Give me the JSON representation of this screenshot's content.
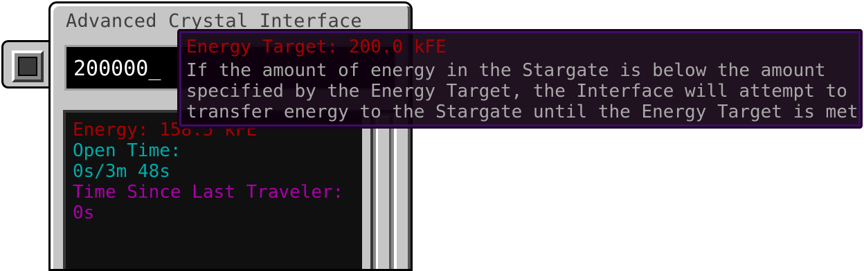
{
  "window": {
    "title": "Advanced Crystal Interface"
  },
  "side_button": {
    "icon": "square-slot-icon"
  },
  "energy_input": {
    "value": "200000_"
  },
  "info": {
    "energy": "Energy: 158.5 kFE",
    "open_time_label": "Open Time:",
    "open_time_value": "0s/3m 48s",
    "last_traveler_label": "Time Since Last Traveler:",
    "last_traveler_value": "0s"
  },
  "tooltip": {
    "title": "Energy Target: 200.0 kFE",
    "lines": [
      "If the amount of energy in the Stargate is below the amount",
      "specified by the Energy Target, the Interface will attempt to",
      "transfer energy to the Stargate until the Energy Target is met"
    ]
  },
  "colors": {
    "energy": "#aa0000",
    "open_time": "#00aaaa",
    "traveler": "#aa00aa",
    "tooltip_title": "#aa0000",
    "tooltip_body": "#a8a8a8",
    "title_text": "#404040"
  }
}
